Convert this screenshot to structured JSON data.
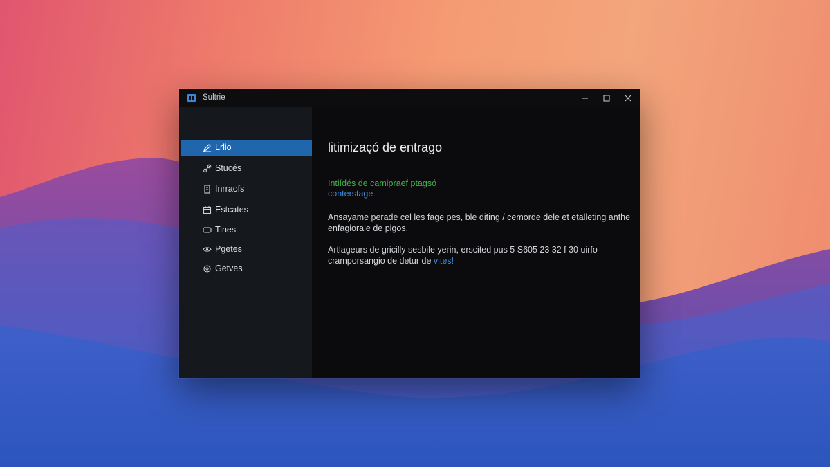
{
  "window": {
    "title": "Sultrie",
    "controls": {
      "minimize_icon": "minimize-icon",
      "maximize_icon": "maximize-icon",
      "close_icon": "close-icon"
    }
  },
  "sidebar": {
    "items": [
      {
        "label": "Lrlio",
        "icon": "pen-icon",
        "active": true
      },
      {
        "label": "Stucés",
        "icon": "link-icon",
        "active": false
      },
      {
        "label": "Inrraofs",
        "icon": "document-icon",
        "active": false
      },
      {
        "label": "Estcates",
        "icon": "calendar-icon",
        "active": false
      },
      {
        "label": "Tines",
        "icon": "display-icon",
        "active": false
      },
      {
        "label": "Pgetes",
        "icon": "eye-icon",
        "active": false
      },
      {
        "label": "Getves",
        "icon": "settings-icon",
        "active": false
      }
    ]
  },
  "content": {
    "heading": "litimizaçó de entrago",
    "green_link": "Intiídés de camipraef ptagsó",
    "blue_link": "conterstage",
    "paragraph1": "Ansayame perade cel les fage pes, ble diting / cemorde dele et etalleting anthe enfagiorale de pigos,",
    "paragraph2_prefix": "Artlageurs de gricilly sesbile yerin, erscited pus 5 S605 23 32 f 30 uirfo cramporsangio de detur de ",
    "paragraph2_link": "vites!"
  },
  "colors": {
    "accent": "#2066ad",
    "link_blue": "#3f8be0",
    "link_green": "#3fb44a"
  }
}
